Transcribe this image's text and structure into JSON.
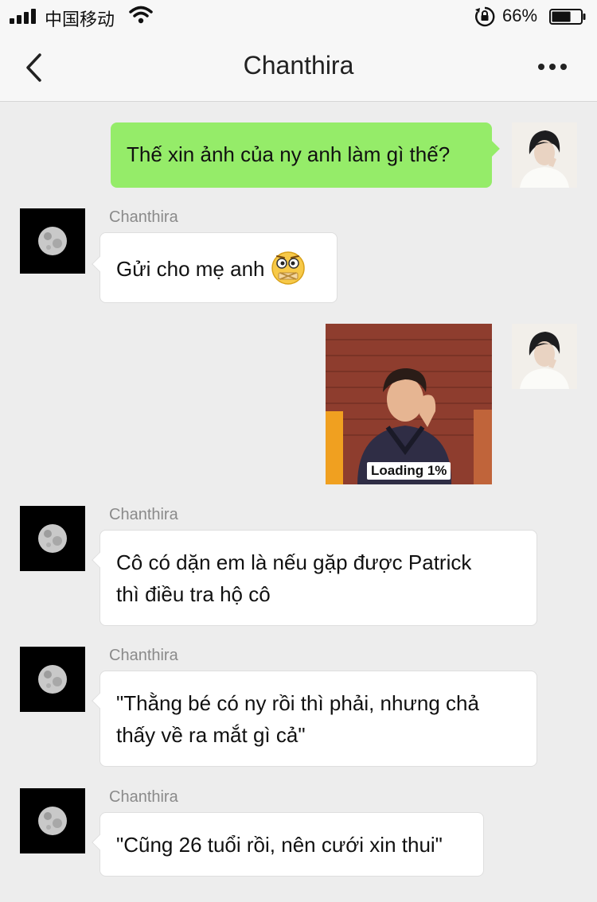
{
  "status_bar": {
    "carrier": "中国移动",
    "battery_percent": "66%",
    "battery_level": 0.66
  },
  "nav": {
    "title": "Chanthira"
  },
  "messages": [
    {
      "from": "me",
      "text": "Thế xin ảnh của ny anh làm gì thế?"
    },
    {
      "from": "Chanthira",
      "sender": "Chanthira",
      "text": "Gửi cho mẹ anh",
      "emoji": "shushing-face-emoji"
    },
    {
      "from": "me",
      "type": "photo",
      "loading_text": "Loading 1%",
      "loading_progress": 0.01
    },
    {
      "from": "Chanthira",
      "sender": "Chanthira",
      "lines": [
        "Cô có dặn em là nếu gặp được Patrick",
        "thì điều tra hộ cô"
      ]
    },
    {
      "from": "Chanthira",
      "sender": "Chanthira",
      "lines": [
        "\"Thằng bé có ny rồi thì phải, nhưng chả",
        "thấy về ra mắt gì cả\""
      ]
    },
    {
      "from": "Chanthira",
      "sender": "Chanthira",
      "text": "\"Cũng 26 tuổi rồi, nên cưới xin thui\""
    }
  ],
  "colors": {
    "outgoing_bubble": "#95ec69",
    "incoming_bubble": "#ffffff",
    "background": "#ededed"
  }
}
